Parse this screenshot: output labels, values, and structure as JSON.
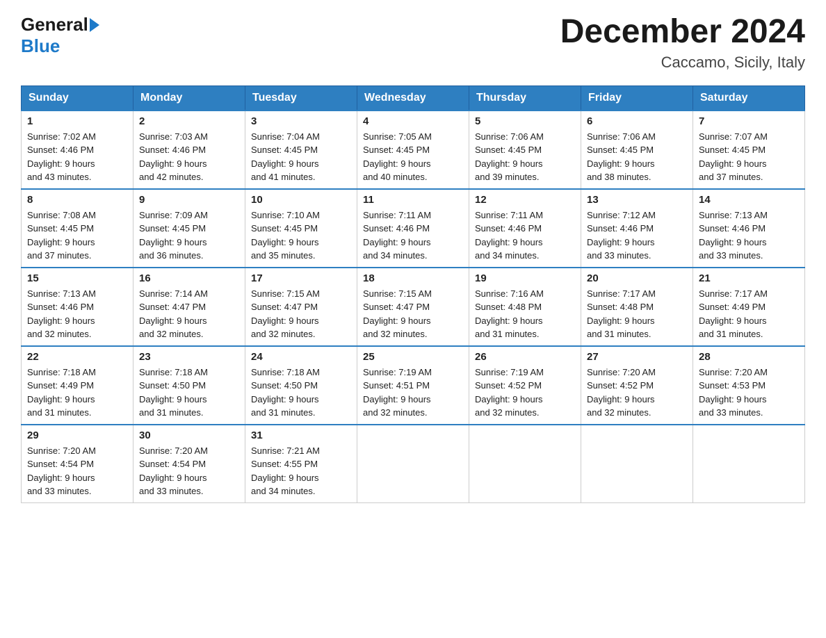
{
  "logo": {
    "general": "General",
    "blue": "Blue"
  },
  "title": "December 2024",
  "subtitle": "Caccamo, Sicily, Italy",
  "days_of_week": [
    "Sunday",
    "Monday",
    "Tuesday",
    "Wednesday",
    "Thursday",
    "Friday",
    "Saturday"
  ],
  "weeks": [
    [
      {
        "day": "1",
        "sunrise": "7:02 AM",
        "sunset": "4:46 PM",
        "daylight": "9 hours and 43 minutes."
      },
      {
        "day": "2",
        "sunrise": "7:03 AM",
        "sunset": "4:46 PM",
        "daylight": "9 hours and 42 minutes."
      },
      {
        "day": "3",
        "sunrise": "7:04 AM",
        "sunset": "4:45 PM",
        "daylight": "9 hours and 41 minutes."
      },
      {
        "day": "4",
        "sunrise": "7:05 AM",
        "sunset": "4:45 PM",
        "daylight": "9 hours and 40 minutes."
      },
      {
        "day": "5",
        "sunrise": "7:06 AM",
        "sunset": "4:45 PM",
        "daylight": "9 hours and 39 minutes."
      },
      {
        "day": "6",
        "sunrise": "7:06 AM",
        "sunset": "4:45 PM",
        "daylight": "9 hours and 38 minutes."
      },
      {
        "day": "7",
        "sunrise": "7:07 AM",
        "sunset": "4:45 PM",
        "daylight": "9 hours and 37 minutes."
      }
    ],
    [
      {
        "day": "8",
        "sunrise": "7:08 AM",
        "sunset": "4:45 PM",
        "daylight": "9 hours and 37 minutes."
      },
      {
        "day": "9",
        "sunrise": "7:09 AM",
        "sunset": "4:45 PM",
        "daylight": "9 hours and 36 minutes."
      },
      {
        "day": "10",
        "sunrise": "7:10 AM",
        "sunset": "4:45 PM",
        "daylight": "9 hours and 35 minutes."
      },
      {
        "day": "11",
        "sunrise": "7:11 AM",
        "sunset": "4:46 PM",
        "daylight": "9 hours and 34 minutes."
      },
      {
        "day": "12",
        "sunrise": "7:11 AM",
        "sunset": "4:46 PM",
        "daylight": "9 hours and 34 minutes."
      },
      {
        "day": "13",
        "sunrise": "7:12 AM",
        "sunset": "4:46 PM",
        "daylight": "9 hours and 33 minutes."
      },
      {
        "day": "14",
        "sunrise": "7:13 AM",
        "sunset": "4:46 PM",
        "daylight": "9 hours and 33 minutes."
      }
    ],
    [
      {
        "day": "15",
        "sunrise": "7:13 AM",
        "sunset": "4:46 PM",
        "daylight": "9 hours and 32 minutes."
      },
      {
        "day": "16",
        "sunrise": "7:14 AM",
        "sunset": "4:47 PM",
        "daylight": "9 hours and 32 minutes."
      },
      {
        "day": "17",
        "sunrise": "7:15 AM",
        "sunset": "4:47 PM",
        "daylight": "9 hours and 32 minutes."
      },
      {
        "day": "18",
        "sunrise": "7:15 AM",
        "sunset": "4:47 PM",
        "daylight": "9 hours and 32 minutes."
      },
      {
        "day": "19",
        "sunrise": "7:16 AM",
        "sunset": "4:48 PM",
        "daylight": "9 hours and 31 minutes."
      },
      {
        "day": "20",
        "sunrise": "7:17 AM",
        "sunset": "4:48 PM",
        "daylight": "9 hours and 31 minutes."
      },
      {
        "day": "21",
        "sunrise": "7:17 AM",
        "sunset": "4:49 PM",
        "daylight": "9 hours and 31 minutes."
      }
    ],
    [
      {
        "day": "22",
        "sunrise": "7:18 AM",
        "sunset": "4:49 PM",
        "daylight": "9 hours and 31 minutes."
      },
      {
        "day": "23",
        "sunrise": "7:18 AM",
        "sunset": "4:50 PM",
        "daylight": "9 hours and 31 minutes."
      },
      {
        "day": "24",
        "sunrise": "7:18 AM",
        "sunset": "4:50 PM",
        "daylight": "9 hours and 31 minutes."
      },
      {
        "day": "25",
        "sunrise": "7:19 AM",
        "sunset": "4:51 PM",
        "daylight": "9 hours and 32 minutes."
      },
      {
        "day": "26",
        "sunrise": "7:19 AM",
        "sunset": "4:52 PM",
        "daylight": "9 hours and 32 minutes."
      },
      {
        "day": "27",
        "sunrise": "7:20 AM",
        "sunset": "4:52 PM",
        "daylight": "9 hours and 32 minutes."
      },
      {
        "day": "28",
        "sunrise": "7:20 AM",
        "sunset": "4:53 PM",
        "daylight": "9 hours and 33 minutes."
      }
    ],
    [
      {
        "day": "29",
        "sunrise": "7:20 AM",
        "sunset": "4:54 PM",
        "daylight": "9 hours and 33 minutes."
      },
      {
        "day": "30",
        "sunrise": "7:20 AM",
        "sunset": "4:54 PM",
        "daylight": "9 hours and 33 minutes."
      },
      {
        "day": "31",
        "sunrise": "7:21 AM",
        "sunset": "4:55 PM",
        "daylight": "9 hours and 34 minutes."
      },
      null,
      null,
      null,
      null
    ]
  ]
}
